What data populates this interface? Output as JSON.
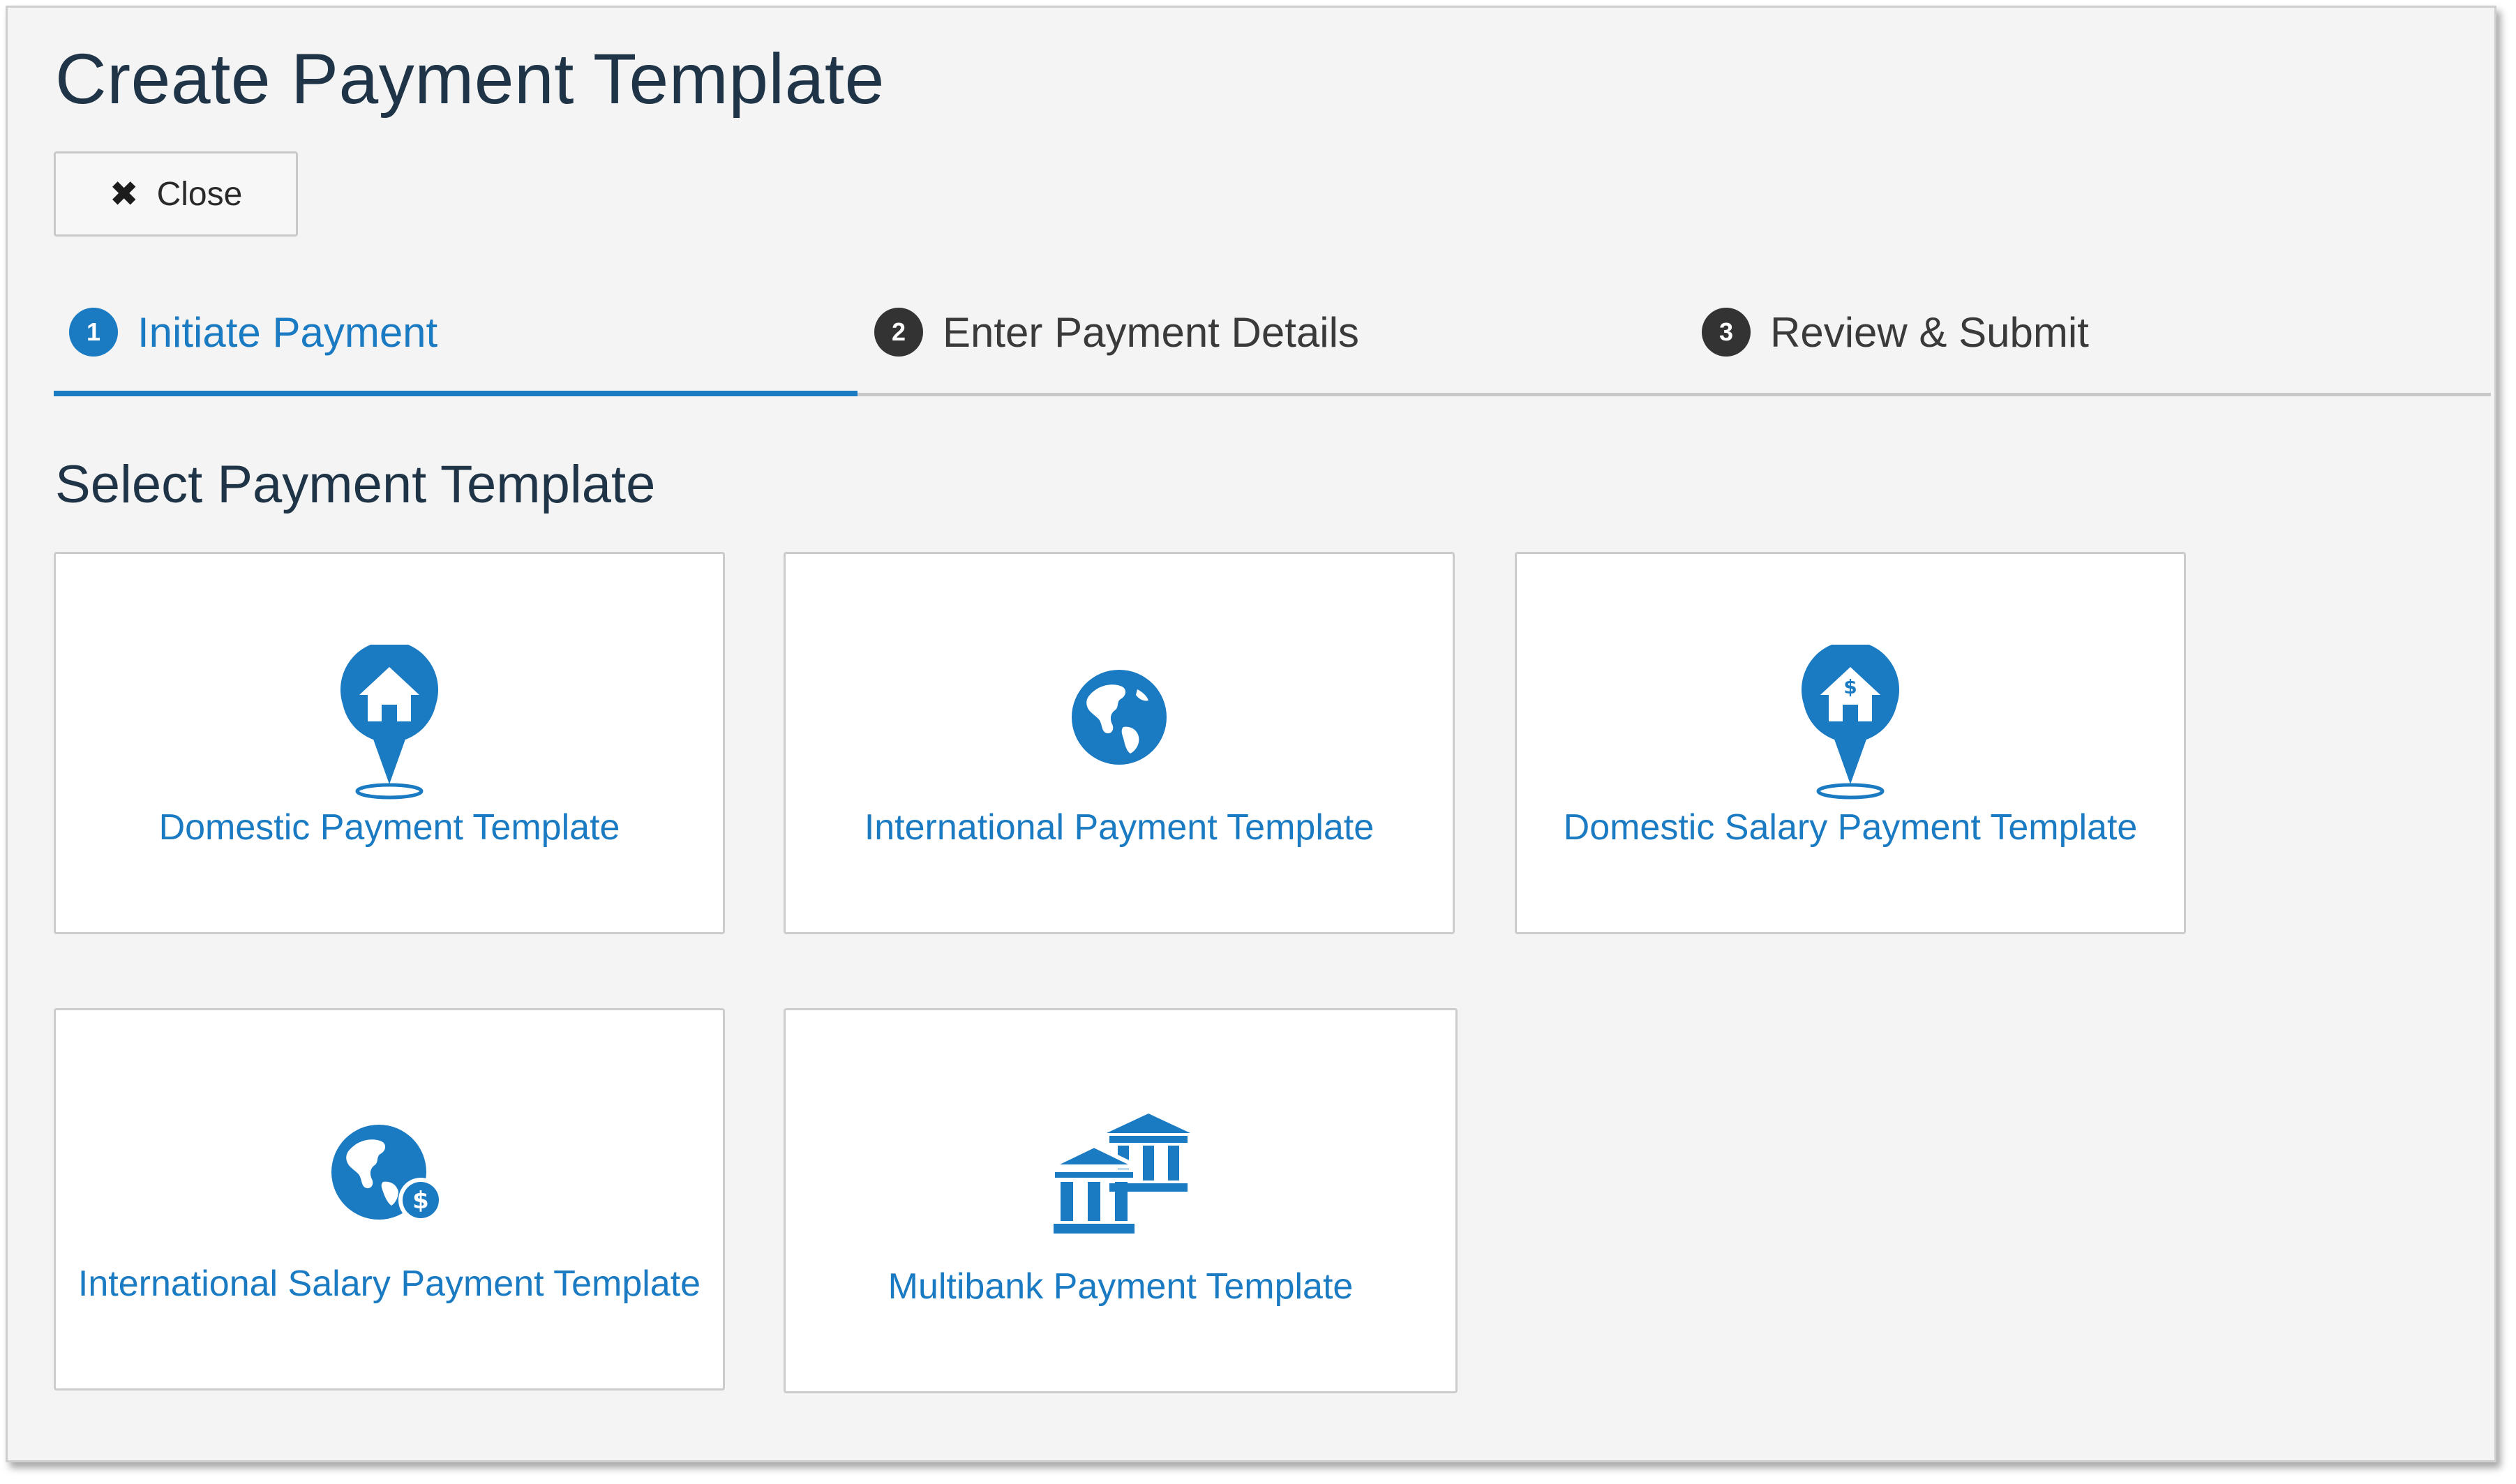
{
  "page": {
    "title": "Create Payment Template",
    "close_label": "Close",
    "section_title": "Select Payment Template"
  },
  "steps": [
    {
      "number": "1",
      "label": "Initiate Payment",
      "active": true
    },
    {
      "number": "2",
      "label": "Enter Payment Details",
      "active": false
    },
    {
      "number": "3",
      "label": "Review & Submit",
      "active": false
    }
  ],
  "templates": [
    {
      "label": "Domestic Payment Template",
      "icon": "home-pin-icon"
    },
    {
      "label": "International Payment Template",
      "icon": "globe-icon"
    },
    {
      "label": "Domestic Salary Payment Template",
      "icon": "home-dollar-pin-icon"
    },
    {
      "label": "International Salary Payment Template",
      "icon": "globe-dollar-icon"
    },
    {
      "label": "Multibank Payment Template",
      "icon": "bank-buildings-icon"
    }
  ],
  "colors": {
    "accent": "#1a7ac2",
    "title_text": "#1f3447",
    "step_inactive": "#333333",
    "panel_bg": "#f4f4f4"
  }
}
